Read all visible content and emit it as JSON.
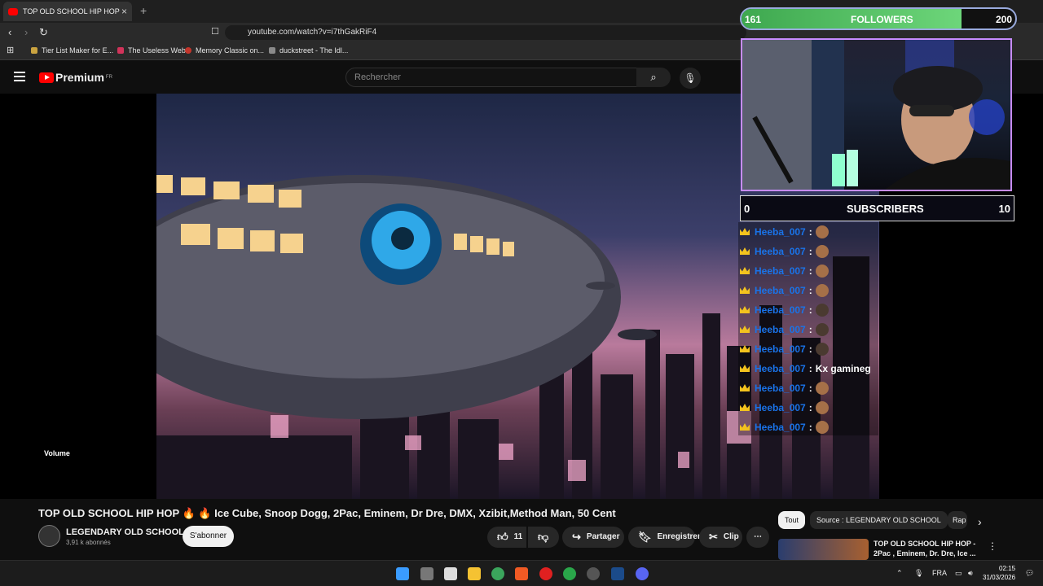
{
  "browser": {
    "tab_title": "TOP OLD SCHOOL HIP HOP 🔥",
    "tab_close": "×",
    "new_tab": "+",
    "url": "youtube.com/watch?v=i7thGakRiF4"
  },
  "bookmarks": [
    {
      "label": "Tier List Maker for E..."
    },
    {
      "label": "The Useless Web"
    },
    {
      "label": "Memory Classic on..."
    },
    {
      "label": "duckstreet - The Idl..."
    }
  ],
  "youtube": {
    "logo": "Premium",
    "region": "FR",
    "search_placeholder": "Rechercher"
  },
  "player": {
    "volume_label": "Volume"
  },
  "overlay": {
    "followers_current": "161",
    "followers_label": "FOLLOWERS",
    "followers_goal": "200",
    "followers_progress": 0.805,
    "subs_current": "0",
    "subs_label": "SUBSCRIBERS",
    "subs_goal": "10"
  },
  "chat": [
    {
      "user": "Heeba_007",
      "msg": "",
      "emote": "monkey"
    },
    {
      "user": "Heeba_007",
      "msg": "",
      "emote": "monkey"
    },
    {
      "user": "Heeba_007",
      "msg": "",
      "emote": "monkey"
    },
    {
      "user": "Heeba_007",
      "msg": "",
      "emote": "monkey"
    },
    {
      "user": "Heeba_007",
      "msg": "",
      "emote": "hand"
    },
    {
      "user": "Heeba_007",
      "msg": "",
      "emote": "hand"
    },
    {
      "user": "Heeba_007",
      "msg": "",
      "emote": "hand"
    },
    {
      "user": "Heeba_007",
      "msg": "Kx gamineg",
      "emote": ""
    },
    {
      "user": "Heeba_007",
      "msg": "",
      "emote": "monkey"
    },
    {
      "user": "Heeba_007",
      "msg": "",
      "emote": "monkey"
    },
    {
      "user": "Heeba_007",
      "msg": "",
      "emote": "monkey"
    }
  ],
  "video": {
    "title": "TOP OLD SCHOOL HIP HOP 🔥 🔥 Ice Cube, Snoop Dogg, 2Pac, Eminem, Dr Dre, DMX, Xzibit,Method Man, 50 Cent",
    "channel": "LEGENDARY OLD SCHOOL",
    "subscribers": "3,91 k abonnés",
    "subscribe_label": "S'abonner",
    "likes": "11",
    "share_label": "Partager",
    "save_label": "Enregistrer",
    "clip_label": "Clip",
    "more": "⋯"
  },
  "chips": {
    "all": "Tout",
    "source": "Source : LEGENDARY OLD SCHOOL",
    "rap": "Rap",
    "next": "›"
  },
  "recommendation": {
    "title": "TOP OLD SCHOOL HIP HOP - 2Pac , Eminem, Dr. Dre, Ice ..."
  },
  "taskbar": {
    "language": "FRA",
    "time": "02:15",
    "date": "31/03/2026"
  }
}
